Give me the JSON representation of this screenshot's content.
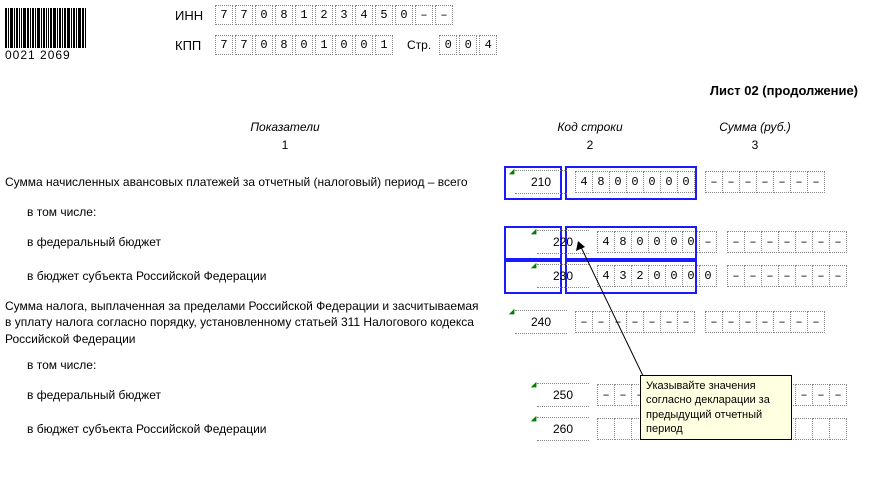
{
  "barcode_number": "0021 2069",
  "inn_label": "ИНН",
  "kpp_label": "КПП",
  "page_abbr": "Стр.",
  "inn": [
    "7",
    "7",
    "0",
    "8",
    "1",
    "2",
    "3",
    "4",
    "5",
    "0",
    "–",
    "–"
  ],
  "kpp": [
    "7",
    "7",
    "0",
    "8",
    "0",
    "1",
    "0",
    "0",
    "1"
  ],
  "page": [
    "0",
    "0",
    "4"
  ],
  "sheet_title": "Лист 02 (продолжение)",
  "headers": {
    "c1": "Показатели",
    "c2": "Код строки",
    "c3": "Сумма (руб.)"
  },
  "nums": {
    "c1": "1",
    "c2": "2",
    "c3": "3"
  },
  "rows": {
    "r210": {
      "label": "Сумма начисленных авансовых платежей за отчетный (налоговый) период – всего",
      "code": "210",
      "sum1": [
        "4",
        "8",
        "0",
        "0",
        "0",
        "0",
        "0"
      ],
      "sum2": [
        "–",
        "–",
        "–",
        "–",
        "–",
        "–",
        "–"
      ]
    },
    "incl": {
      "label": "в том числе:"
    },
    "r220": {
      "label": "в федеральный бюджет",
      "code": "220",
      "sum1": [
        "4",
        "8",
        "0",
        "0",
        "0",
        "0",
        "–"
      ],
      "sum2": [
        "–",
        "–",
        "–",
        "–",
        "–",
        "–",
        "–"
      ]
    },
    "r230": {
      "label": "в бюджет субъекта Российской Федерации",
      "code": "230",
      "sum1": [
        "4",
        "3",
        "2",
        "0",
        "0",
        "0",
        "0"
      ],
      "sum2": [
        "–",
        "–",
        "–",
        "–",
        "–",
        "–",
        "–"
      ]
    },
    "r240": {
      "label": "Сумма налога, выплаченная за пределами Российской Федерации и засчитываемая в уплату налога согласно порядку, установленному статьей 311 Налогового кодекса Российской Федерации",
      "code": "240",
      "sum1": [
        "–",
        "–",
        "–",
        "–",
        "–",
        "–",
        "–"
      ],
      "sum2": [
        "–",
        "–",
        "–",
        "–",
        "–",
        "–",
        "–"
      ]
    },
    "incl2": {
      "label": "в том числе:"
    },
    "r250": {
      "label": "в федеральный бюджет",
      "code": "250",
      "sum1": [
        "–",
        "–",
        "–",
        "–",
        "–",
        "–",
        "–"
      ],
      "sum2": [
        "–",
        "–",
        "–",
        "–",
        "–",
        "–",
        "–"
      ]
    },
    "r260": {
      "label": "в бюджет субъекта Российской Федерации",
      "code": "260",
      "sum1": [
        "",
        "",
        "",
        "",
        "",
        "",
        ""
      ],
      "sum2": [
        "",
        "",
        "",
        "",
        "",
        "",
        ""
      ]
    }
  },
  "tooltip": "Указывайте значения согласно декларации за предыдущий отчетный период"
}
